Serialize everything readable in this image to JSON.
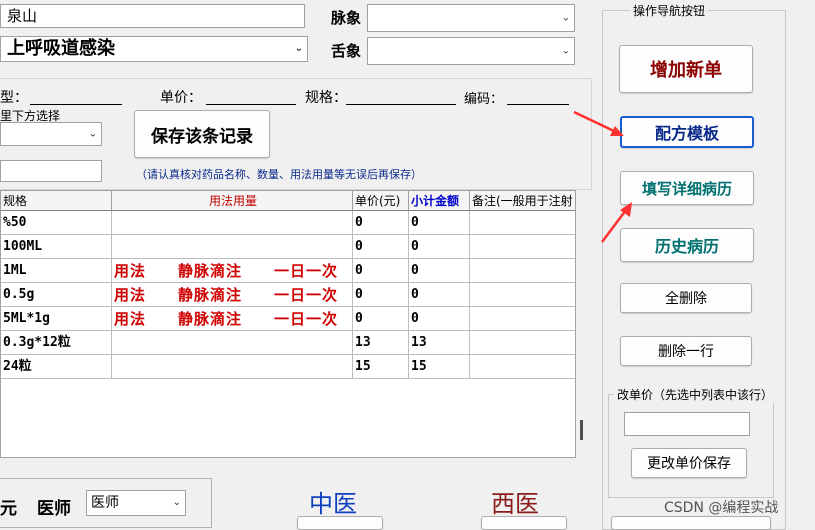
{
  "top": {
    "patient_value": "泉山",
    "diagnosis_value": "上呼吸道感染",
    "pulse_label": "脉象",
    "tongue_label": "舌象"
  },
  "drug_form": {
    "type_label": "型：",
    "price_label": "单价：",
    "spec_label": "规格：",
    "code_label": "编码：",
    "select_hint": "里下方选择",
    "save_record_label": "保存该条记录",
    "notice": "（请认真核对药品名称、数量、用法用量等无误后再保存）"
  },
  "table": {
    "headers": [
      "规格",
      "用法用量",
      "单价(元)",
      "小计金额",
      "备注(一般用于注射"
    ],
    "rows": [
      {
        "spec": "%50",
        "usage": "",
        "price": "0",
        "subtotal": "0"
      },
      {
        "spec": "100ML",
        "usage": "",
        "price": "0",
        "subtotal": "0"
      },
      {
        "spec": "1ML",
        "usage": "用法　　静脉滴注　　一日一次",
        "price": "0",
        "subtotal": "0"
      },
      {
        "spec": "0.5g",
        "usage": "用法　　静脉滴注　　一日一次",
        "price": "0",
        "subtotal": "0"
      },
      {
        "spec": "5ML*1g",
        "usage": "用法　　静脉滴注　　一日一次",
        "price": "0",
        "subtotal": "0"
      },
      {
        "spec": "0.3g*12粒",
        "usage": "",
        "price": "13",
        "subtotal": "13"
      },
      {
        "spec": "24粒",
        "usage": "",
        "price": "15",
        "subtotal": "15"
      }
    ]
  },
  "bottom": {
    "currency_label": "元",
    "doctor_label": "医师",
    "doctor_value": "医师",
    "tcm_label": "中医",
    "western_label": "西医"
  },
  "nav": {
    "group_title": "操作导航按钮",
    "add_new": "增加新单",
    "template": "配方模板",
    "fill_record": "填写详细病历",
    "history": "历史病历",
    "delete_all": "全删除",
    "delete_row": "删除一行",
    "price_group_title": "改单价（先选中列表中该行）",
    "price_input": "",
    "save_price": "更改单价保存"
  },
  "watermark": "CSDN @编程实战",
  "colors": {
    "usage_red": "#d00000",
    "add_new_red": "#8b0000",
    "template_blue": "#0a2a8a",
    "teal": "#007070",
    "tcm_blue": "#1040c0",
    "western_dark_red": "#8b1a1a",
    "arrow_red": "#ff3030",
    "subtotal_header_blue": "#0000cc"
  }
}
